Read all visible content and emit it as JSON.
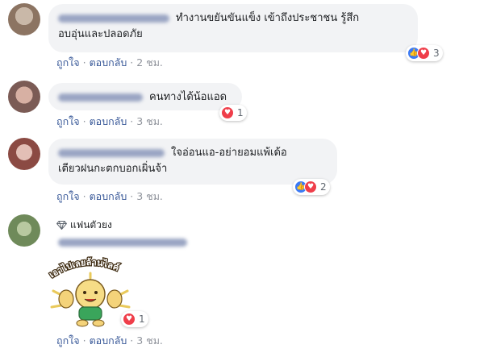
{
  "comments": [
    {
      "text_lines": [
        "ทำงานขยันขันแข็ง เข้าถึงประชาชน รู้สึก",
        "อบอุ่นและปลอดภัย"
      ],
      "reactions": {
        "types": [
          "like",
          "love"
        ],
        "count": "3"
      },
      "actions": {
        "like": "ถูกใจ",
        "reply": "ตอบกลับ",
        "time": "2 ชม."
      }
    },
    {
      "text_lines": [
        "คนทางได้น้อแอด"
      ],
      "reactions": {
        "types": [
          "love"
        ],
        "count": "1"
      },
      "actions": {
        "like": "ถูกใจ",
        "reply": "ตอบกลับ",
        "time": "3 ชม."
      }
    },
    {
      "text_lines": [
        "ใจอ่อนแอ-อย่ายอมแพ้เด้อ",
        "เตียวฝนกะตกบอกเผิ่นจ้า"
      ],
      "reactions": {
        "types": [
          "like",
          "love"
        ],
        "count": "2"
      },
      "actions": {
        "like": "ถูกใจ",
        "reply": "ตอบกลับ",
        "time": "3 ชม."
      }
    },
    {
      "badge": "แฟนตัวยง",
      "sticker_text": "เอาไปเลยล้านไลค์",
      "reactions": {
        "types": [
          "love"
        ],
        "count": "1"
      },
      "actions": {
        "like": "ถูกใจ",
        "reply": "ตอบกลับ",
        "time": "3 ชม."
      }
    }
  ],
  "icons": {
    "like": "thumbs-up-icon",
    "love": "heart-icon",
    "badge": "diamond-icon"
  },
  "colors": {
    "link": "#385898",
    "bubble": "#f2f3f5",
    "like": "#3b7af6",
    "love": "#ef3e4a"
  }
}
